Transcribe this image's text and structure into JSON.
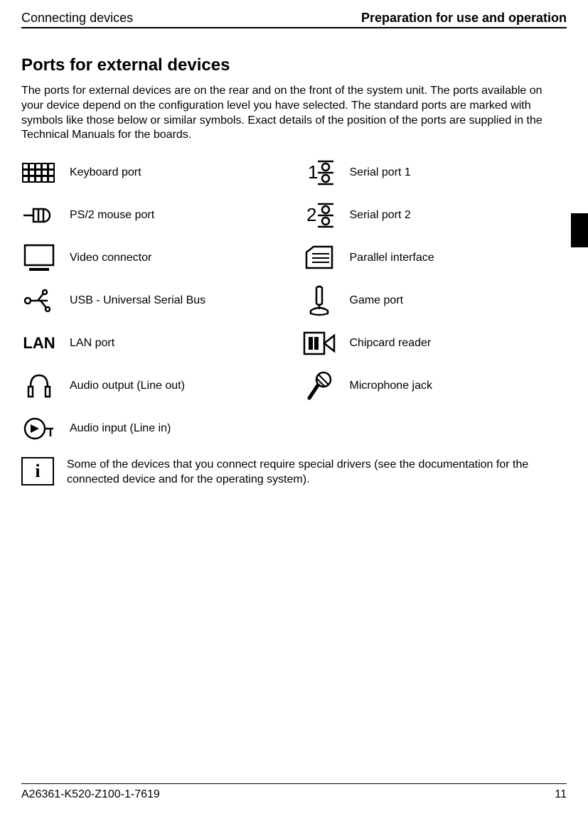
{
  "header": {
    "left": "Connecting devices",
    "right": "Preparation for use and operation"
  },
  "heading": "Ports for external devices",
  "intro": "The ports for external devices are on the rear and on the front of the system unit. The ports available on your device depend on the configuration level you have selected. The standard ports are marked with symbols like those below or similar symbols. Exact details of the position of the ports are supplied in the Technical Manuals for the boards.",
  "ports": {
    "keyboard": "Keyboard port",
    "serial1": "Serial port 1",
    "ps2": "PS/2 mouse port",
    "serial2": "Serial port 2",
    "video": "Video connector",
    "parallel": "Parallel interface",
    "usb": "USB - Universal Serial Bus",
    "game": "Game port",
    "lan": "LAN port",
    "chipcard": "Chipcard reader",
    "audio_out": "Audio output (Line out)",
    "mic": "Microphone jack",
    "audio_in": "Audio input (Line in)"
  },
  "lan_symbol": "LAN",
  "info": {
    "symbol": "i",
    "text": "Some of the devices that you connect require special drivers (see the documentation for the connected device and for the operating system)."
  },
  "footer": {
    "left": "A26361-K520-Z100-1-7619",
    "right": "11"
  }
}
